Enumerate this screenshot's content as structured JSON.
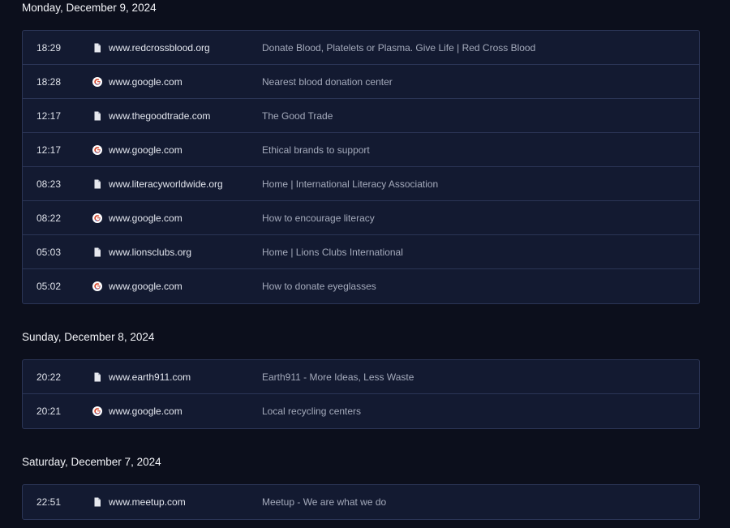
{
  "days": [
    {
      "heading": "Monday, December 9, 2024",
      "entries": [
        {
          "time": "18:29",
          "icon": "page-icon",
          "domain": "www.redcrossblood.org",
          "title": "Donate Blood, Platelets or Plasma. Give Life | Red Cross Blood"
        },
        {
          "time": "18:28",
          "icon": "google-icon",
          "domain": "www.google.com",
          "title": "Nearest blood donation center"
        },
        {
          "time": "12:17",
          "icon": "page-icon",
          "domain": "www.thegoodtrade.com",
          "title": "The Good Trade"
        },
        {
          "time": "12:17",
          "icon": "google-icon",
          "domain": "www.google.com",
          "title": "Ethical brands to support"
        },
        {
          "time": "08:23",
          "icon": "page-icon",
          "domain": "www.literacyworldwide.org",
          "title": "Home | International Literacy Association"
        },
        {
          "time": "08:22",
          "icon": "google-icon",
          "domain": "www.google.com",
          "title": "How to encourage literacy"
        },
        {
          "time": "05:03",
          "icon": "page-icon",
          "domain": "www.lionsclubs.org",
          "title": "Home | Lions Clubs International"
        },
        {
          "time": "05:02",
          "icon": "google-icon",
          "domain": "www.google.com",
          "title": "How to donate eyeglasses"
        }
      ]
    },
    {
      "heading": "Sunday, December 8, 2024",
      "entries": [
        {
          "time": "20:22",
          "icon": "page-icon",
          "domain": "www.earth911.com",
          "title": "Earth911 - More Ideas, Less Waste"
        },
        {
          "time": "20:21",
          "icon": "google-icon",
          "domain": "www.google.com",
          "title": "Local recycling centers"
        }
      ]
    },
    {
      "heading": "Saturday, December 7, 2024",
      "entries": [
        {
          "time": "22:51",
          "icon": "page-icon",
          "domain": "www.meetup.com",
          "title": "Meetup - We are what we do"
        }
      ]
    }
  ]
}
